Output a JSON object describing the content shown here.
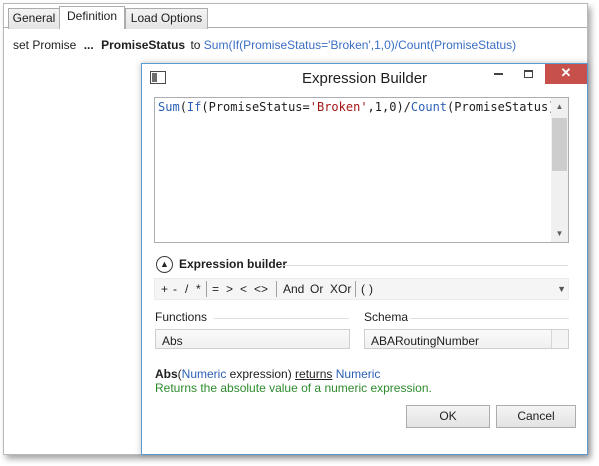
{
  "tabs": [
    {
      "label": "General"
    },
    {
      "label": "Definition"
    },
    {
      "label": "Load Options"
    }
  ],
  "definition": {
    "prefix": "set Promise",
    "ellipsis": "...",
    "field": "PromiseStatus",
    "to": "to",
    "expression": "Sum(If(PromiseStatus='Broken',1,0)/Count(PromiseStatus)"
  },
  "dialog": {
    "title": "Expression Builder",
    "close_glyph": "✕",
    "editor": {
      "fn1": "Sum",
      "p1": "(",
      "fn2": "If",
      "p2": "(PromiseStatus=",
      "str": "'Broken'",
      "p3": ",1,0)/",
      "fn3": "Count",
      "p4": "(PromiseStatus)"
    },
    "expression_builder_label": "Expression builder",
    "operators": {
      "arith": [
        "+",
        "-",
        "/",
        "*"
      ],
      "compare": [
        "=",
        ">",
        "<",
        "<>"
      ],
      "logic": [
        "And",
        "Or",
        "XOr"
      ],
      "parens": [
        "(",
        ")"
      ]
    },
    "functions_label": "Functions",
    "schema_label": "Schema",
    "functions_selected": "Abs",
    "schema_selected": "ABARoutingNumber",
    "signature": {
      "name": "Abs",
      "open": "(",
      "type": "Numeric",
      "rest": " expression) ",
      "returns": "returns",
      "return_type": "Numeric"
    },
    "description": "Returns the absolute value of a numeric expression.",
    "ok_label": "OK",
    "cancel_label": "Cancel"
  },
  "colors": {
    "accent": "#2b5fb5",
    "close_button": "#c7504b",
    "description": "#2e8b2e",
    "string_literal": "#a31515"
  },
  "icons": [
    "window-app-icon",
    "minimize-icon",
    "maximize-icon",
    "close-icon",
    "collapse-chevron-icon",
    "scroll-up-icon",
    "scroll-down-icon"
  ]
}
